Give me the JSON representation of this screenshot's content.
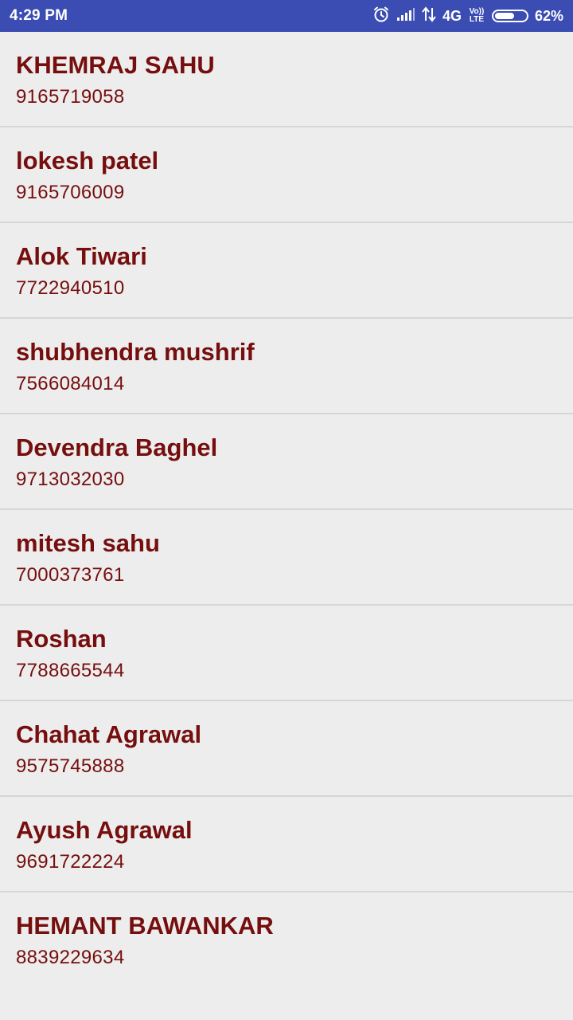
{
  "status_bar": {
    "time": "4:29 PM",
    "network_type": "4G",
    "volte_top": "Vo))",
    "volte_bottom": "LTE",
    "battery_percent": "62%",
    "battery_level": 0.62,
    "icons": [
      "alarm-icon",
      "signal-icon",
      "data-arrows-icon",
      "volte-icon",
      "battery-icon"
    ]
  },
  "contacts": [
    {
      "name": "KHEMRAJ SAHU",
      "phone": "9165719058"
    },
    {
      "name": "lokesh patel",
      "phone": "9165706009"
    },
    {
      "name": "Alok Tiwari",
      "phone": "7722940510"
    },
    {
      "name": "shubhendra mushrif",
      "phone": "7566084014"
    },
    {
      "name": "Devendra Baghel",
      "phone": "9713032030"
    },
    {
      "name": "mitesh sahu",
      "phone": "7000373761"
    },
    {
      "name": "Roshan",
      "phone": "7788665544"
    },
    {
      "name": "Chahat Agrawal",
      "phone": "9575745888"
    },
    {
      "name": "Ayush Agrawal",
      "phone": "9691722224"
    },
    {
      "name": "HEMANT BAWANKAR",
      "phone": "8839229634"
    }
  ],
  "colors": {
    "status_bar_bg": "#3b4db3",
    "page_bg": "#ededed",
    "contact_text": "#760e0e",
    "divider": "#d6d6d6"
  }
}
